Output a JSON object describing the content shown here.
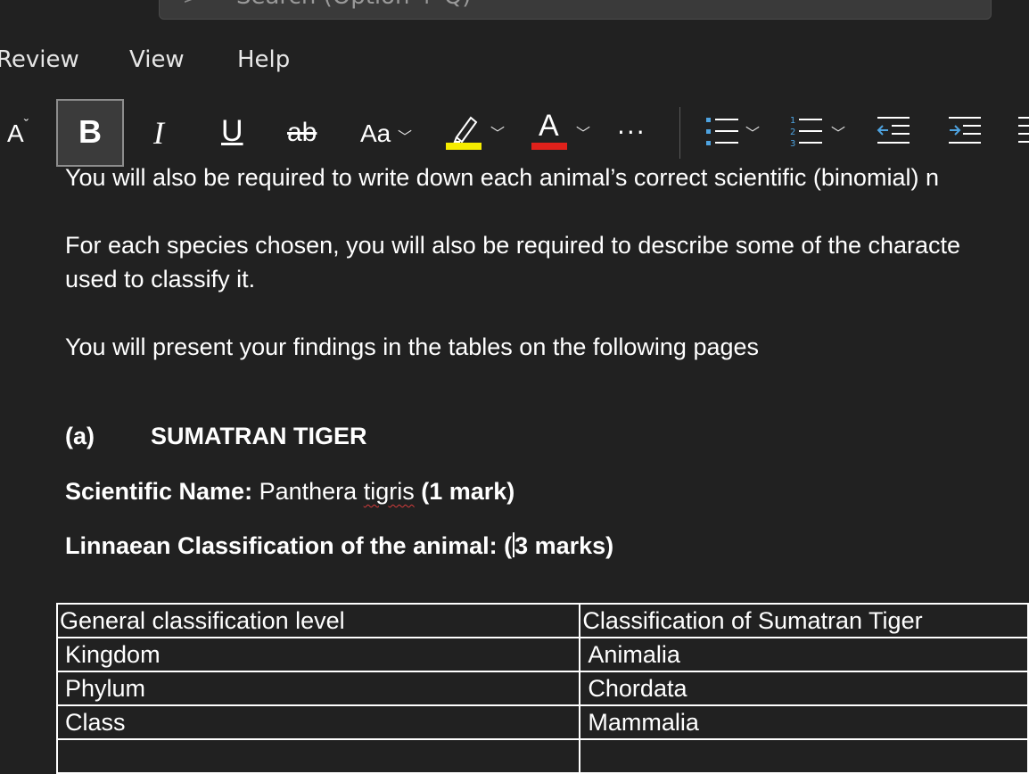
{
  "search": {
    "placeholder": "Search (Option + Q)"
  },
  "menu": {
    "items": [
      "Review",
      "View",
      "Help"
    ]
  },
  "ribbon": {
    "font_size_label": "A",
    "bold_label": "B",
    "italic_label": "I",
    "underline_label": "U",
    "strike_label": "ab",
    "case_label": "Aa",
    "font_color_label": "A",
    "more_label": "···",
    "highlight_color": "#f5ec00",
    "font_color": "#e0211b"
  },
  "document": {
    "paragraphs": [
      "You will also be required to write down each animal’s correct scientific (binomial) n",
      "For each species chosen, you will also be required to describe some of the characte",
      "used to classify it.",
      "You will present your findings in the tables on the following pages"
    ],
    "heading": {
      "letter": "(a)",
      "title": "SUMATRAN TIGER"
    },
    "scientific": {
      "label": "Scientific Name:",
      "name_first": "Panthera",
      "name_second": "tigris",
      "marks": "(1 mark)"
    },
    "linnaean": {
      "label": "Linnaean Classification of the animal: (",
      "marks": "3 marks)"
    },
    "table": {
      "headers": [
        "General classification level",
        "Classification of Sumatran Tiger"
      ],
      "rows": [
        [
          "Kingdom",
          "Animalia"
        ],
        [
          "Phylum",
          "Chordata"
        ],
        [
          "Class",
          "Mammalia"
        ],
        [
          "",
          ""
        ]
      ]
    }
  }
}
